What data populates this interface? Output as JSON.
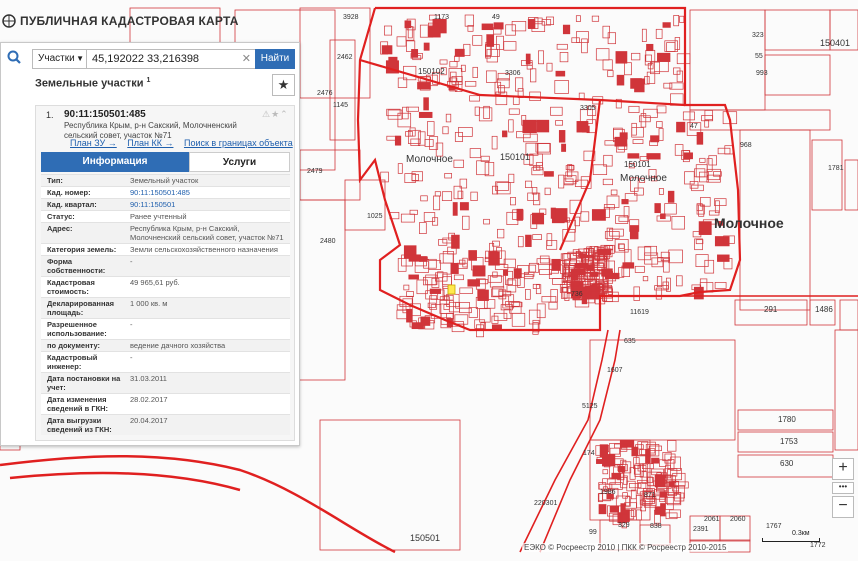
{
  "app": {
    "title": "ПУБЛИЧНАЯ КАДАСТРОВАЯ КАРТА"
  },
  "search": {
    "type": "Участки",
    "query": "45,192022 33,216398",
    "button": "Найти"
  },
  "section": {
    "title": "Земельные участки",
    "count": "1"
  },
  "result": {
    "num": "1.",
    "cad_number": "90:11:150501:485",
    "address": "Республика Крым, р-н Сакский, Молочненский сельский совет, участок №71",
    "links": [
      "План ЗУ →",
      "План КК →",
      "Поиск в границах объекта →"
    ]
  },
  "tabs": {
    "info": "Информация",
    "services": "Услуги"
  },
  "properties": [
    {
      "label": "Тип:",
      "value": "Земельный участок",
      "link": false
    },
    {
      "label": "Кад. номер:",
      "value": "90:11:150501:485",
      "link": true
    },
    {
      "label": "Кад. квартал:",
      "value": "90:11:150501",
      "link": true
    },
    {
      "label": "Статус:",
      "value": "Ранее учтенный",
      "link": false
    },
    {
      "label": "Адрес:",
      "value": "Республика Крым, р-н Сакский, Молочненский сельский совет, участок №71",
      "link": false
    },
    {
      "label": "Категория земель:",
      "value": "Земли сельскохозяйственного назначения",
      "link": false
    },
    {
      "label": "Форма собственности:",
      "value": "-",
      "link": false
    },
    {
      "label": "Кадастровая стоимость:",
      "value": "49 965,61 руб.",
      "link": false
    },
    {
      "label": "Декларированная площадь:",
      "value": "1 000 кв. м",
      "link": false
    },
    {
      "label": "Разрешенное использование:",
      "value": "-",
      "link": false
    },
    {
      "label": "по документу:",
      "value": "ведение дачного хозяйства",
      "link": false
    },
    {
      "label": "Кадастровый инженер:",
      "value": "-",
      "link": false
    },
    {
      "label": "Дата постановки на учет:",
      "value": "31.03.2011",
      "link": false
    },
    {
      "label": "Дата изменения сведений в ГКН:",
      "value": "28.02.2017",
      "link": false
    },
    {
      "label": "Дата выгрузки сведений из ГКН:",
      "value": "20.04.2017",
      "link": false
    }
  ],
  "map": {
    "labels": [
      "3928",
      "1173",
      "49",
      "323",
      "150401",
      "2462",
      "150102",
      "3306",
      "55",
      "993",
      "2476",
      "1145",
      "150101",
      "3305",
      "150101",
      "Молочное",
      "Молочное",
      "47",
      "968",
      "1781",
      "2479",
      "1025",
      "Молочное",
      "2480",
      "291",
      "1486",
      "736",
      "11619",
      "635",
      "1607",
      "5125",
      "1780",
      "1753",
      "630",
      "871",
      "220301",
      "150501",
      "329",
      "838",
      "2391",
      "2061",
      "2060",
      "1767",
      "1772",
      "99",
      "174",
      "1986"
    ]
  },
  "zoom": {
    "plus": "+",
    "minus": "−"
  },
  "attribution": "ЕЭКО © Росреестр 2010 | ПКК © Росреестр 2010-2015",
  "scale": "0.3км",
  "colors": {
    "parcel": "#d0353a",
    "boundary": "#e02020",
    "accent": "#2f6db5"
  }
}
